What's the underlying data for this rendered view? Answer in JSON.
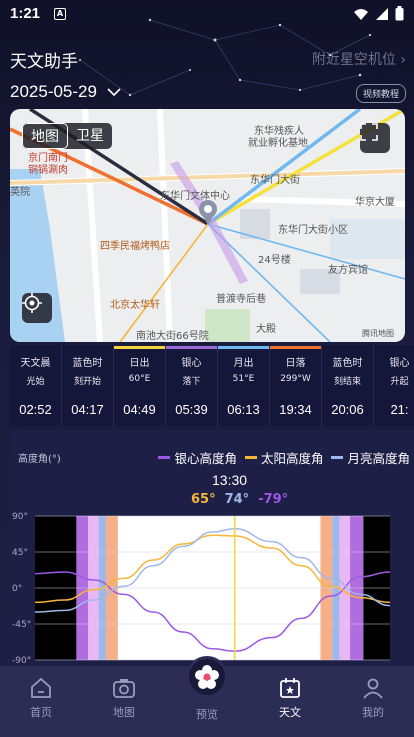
{
  "status_bar": {
    "time": "1:21",
    "notif": "A"
  },
  "header": {
    "app_title": "天文助手",
    "nearby_link": "附近星空机位",
    "date": "2025-05-29",
    "tutorial_button": "视频教程"
  },
  "map": {
    "tabs": [
      {
        "label": "地图",
        "active": true
      },
      {
        "label": "卫星",
        "active": false
      }
    ],
    "labels": {
      "label_01": "东华残疾人",
      "label_02": "就业孵化基地",
      "label_03": "东华门大街",
      "label_04": "京门南门",
      "label_05": "铜锅涮肉",
      "label_06": "东华门文体中心",
      "label_07": "华京大厦",
      "label_08": "英院",
      "label_09": "东华门大街小区",
      "label_10": "四季民福烤鸭店",
      "label_11": "24号楼",
      "label_12": "友方宾馆",
      "label_13": "北京太华轩",
      "label_14": "普渡寺后巷",
      "label_15": "南池大街66号院",
      "label_16": "大殿",
      "label_17": "腾讯地图"
    }
  },
  "timeline": [
    {
      "line1": "天文晨",
      "line2": "光始",
      "time": "02:52",
      "bar": ""
    },
    {
      "line1": "蓝色时",
      "line2": "刻开始",
      "time": "04:17",
      "bar": ""
    },
    {
      "line1": "日出",
      "line2": "60°E",
      "time": "04:49",
      "bar": "#f5d33a"
    },
    {
      "line1": "银心",
      "line2": "落下",
      "time": "05:39",
      "bar": "#9b6bd8"
    },
    {
      "line1": "月出",
      "line2": "51°E",
      "time": "06:13",
      "bar": "#6fb8f0"
    },
    {
      "line1": "日落",
      "line2": "299°W",
      "time": "19:34",
      "bar": "#f07030"
    },
    {
      "line1": "蓝色时",
      "line2": "刻结束",
      "time": "20:06",
      "bar": ""
    },
    {
      "line1": "银心",
      "line2": "升起",
      "time": "21:",
      "bar": ""
    }
  ],
  "chart": {
    "y_axis_label": "高度角(°)",
    "current_time": "13:30",
    "current_values": {
      "sun": "65°",
      "moon": "74°",
      "galaxy": "-79°"
    },
    "colors": {
      "galaxy": "#9b59e6",
      "sun": "#f5b63a",
      "moon": "#9fb8e8"
    }
  },
  "chart_data": {
    "type": "line",
    "title": "",
    "ylabel": "高度角(°)",
    "ylim": [
      -90,
      90
    ],
    "y_ticks": [
      "90°",
      "45°",
      "0°",
      "-45°",
      "-90°"
    ],
    "x_ticks": [
      "",
      "",
      ""
    ],
    "x": [
      0,
      2,
      4,
      6,
      8,
      10,
      12,
      13.5,
      16,
      18,
      20,
      22,
      24
    ],
    "series": [
      {
        "name": "银心高度角",
        "values": [
          18,
          20,
          10,
          -8,
          -30,
          -55,
          -76,
          -79,
          -62,
          -38,
          -10,
          14,
          20
        ]
      },
      {
        "name": "太阳高度角",
        "values": [
          -18,
          -15,
          -2,
          12,
          35,
          55,
          66,
          65,
          50,
          28,
          2,
          -12,
          -18
        ]
      },
      {
        "name": "月亮高度角",
        "values": [
          -30,
          -28,
          -15,
          2,
          28,
          52,
          70,
          74,
          58,
          38,
          12,
          -8,
          -22
        ]
      }
    ]
  },
  "nav": {
    "items": [
      {
        "label": "首页",
        "active": false
      },
      {
        "label": "地图",
        "active": false
      },
      {
        "label": "预览",
        "active": false
      },
      {
        "label": "天文",
        "active": true
      },
      {
        "label": "我的",
        "active": false
      }
    ]
  }
}
